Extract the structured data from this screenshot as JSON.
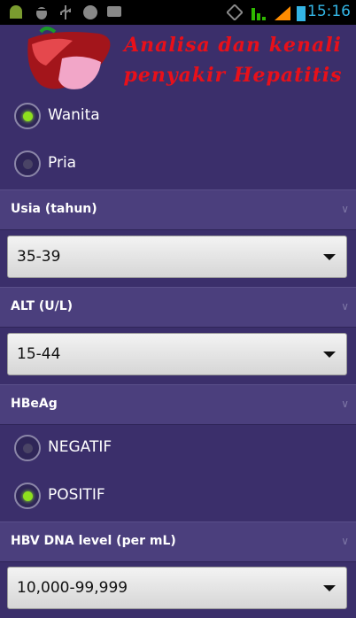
{
  "status_bar": {
    "time": "15:16",
    "icons": [
      "android-icon",
      "bug-icon",
      "usb-icon",
      "bbm-icon",
      "chat-icon",
      "rotate-icon",
      "wifi-icon",
      "signal-icon",
      "battery-icon"
    ]
  },
  "header": {
    "title_line1": "Analisa dan kenali",
    "title_line2": "penyakir Hepatitis",
    "logo_icon": "liver-icon"
  },
  "gender": {
    "options": [
      {
        "label": "Wanita",
        "checked": true
      },
      {
        "label": "Pria",
        "checked": false
      }
    ]
  },
  "usia": {
    "title": "Usia (tahun)",
    "value": "35-39"
  },
  "alt": {
    "title": "ALT (U/L)",
    "value": "15-44"
  },
  "hbeag": {
    "title": "HBeAg",
    "options": [
      {
        "label": "NEGATIF",
        "checked": false
      },
      {
        "label": "POSITIF",
        "checked": true
      }
    ]
  },
  "hbv": {
    "title": "HBV DNA level (per mL)",
    "value": "10,000-99,999"
  },
  "colors": {
    "background": "#3b2f6b",
    "section_header": "#4b3f7d",
    "title_red": "#e8101a",
    "radio_on": "#8ee01e",
    "status_blue": "#33b5e5"
  }
}
